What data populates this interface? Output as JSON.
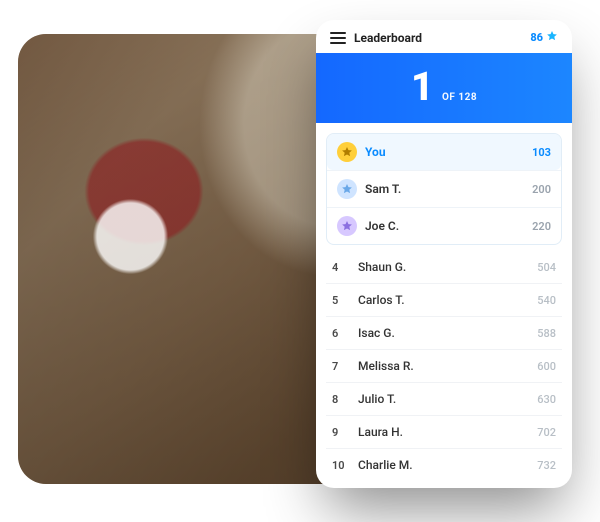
{
  "header": {
    "title": "Leaderboard",
    "points": "86"
  },
  "banner": {
    "rank": "1",
    "of_label": "OF 128"
  },
  "podium": [
    {
      "name": "You",
      "score": "103",
      "medal": "gold",
      "is_self": true
    },
    {
      "name": "Sam T.",
      "score": "200",
      "medal": "silver",
      "is_self": false
    },
    {
      "name": "Joe C.",
      "score": "220",
      "medal": "bronze",
      "is_self": false
    }
  ],
  "list": [
    {
      "rank": "4",
      "name": "Shaun G.",
      "score": "504"
    },
    {
      "rank": "5",
      "name": "Carlos T.",
      "score": "540"
    },
    {
      "rank": "6",
      "name": "Isac G.",
      "score": "588"
    },
    {
      "rank": "7",
      "name": "Melissa R.",
      "score": "600"
    },
    {
      "rank": "8",
      "name": "Julio T.",
      "score": "630"
    },
    {
      "rank": "9",
      "name": "Laura H.",
      "score": "702"
    },
    {
      "rank": "10",
      "name": "Charlie M.",
      "score": "732"
    }
  ]
}
